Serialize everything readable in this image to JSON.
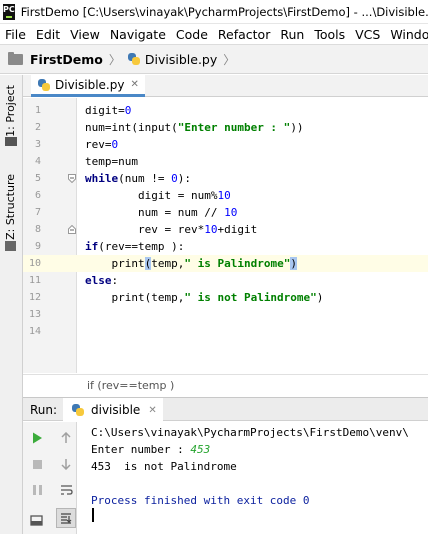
{
  "window": {
    "title": "FirstDemo [C:\\Users\\vinayak\\PycharmProjects\\FirstDemo] - ...\\Divisible.py [FirstDemo] - PyCharm",
    "logo": "PC"
  },
  "menu": [
    "File",
    "Edit",
    "View",
    "Navigate",
    "Code",
    "Refactor",
    "Run",
    "Tools",
    "VCS",
    "Window"
  ],
  "navbar": {
    "project": "FirstDemo",
    "file": "Divisible.py"
  },
  "side_tabs": {
    "project": "1: Project",
    "structure": "Z: Structure"
  },
  "editor": {
    "tab_label": "Divisible.py",
    "line_numbers": [
      "1",
      "2",
      "3",
      "4",
      "5",
      "6",
      "7",
      "8",
      "9",
      "10",
      "11",
      "12",
      "13",
      "14"
    ],
    "breadcrumb": "if (rev==temp )"
  },
  "run_panel": {
    "label": "Run:",
    "tab_label": "divisible"
  },
  "console": {
    "command": "C:\\Users\\vinayak\\PycharmProjects\\FirstDemo\\venv\\",
    "prompt": "Enter number : ",
    "input": "453",
    "output": "453  is not Palindrome",
    "finished": "Process finished with exit code 0"
  },
  "colors": {
    "keyword": "#000080",
    "string": "#008000",
    "number": "#0000ff",
    "current_line": "#fffde6",
    "console_finished": "#0a1f9e",
    "user_input": "#24a32d",
    "run_green": "#3bab3b"
  }
}
